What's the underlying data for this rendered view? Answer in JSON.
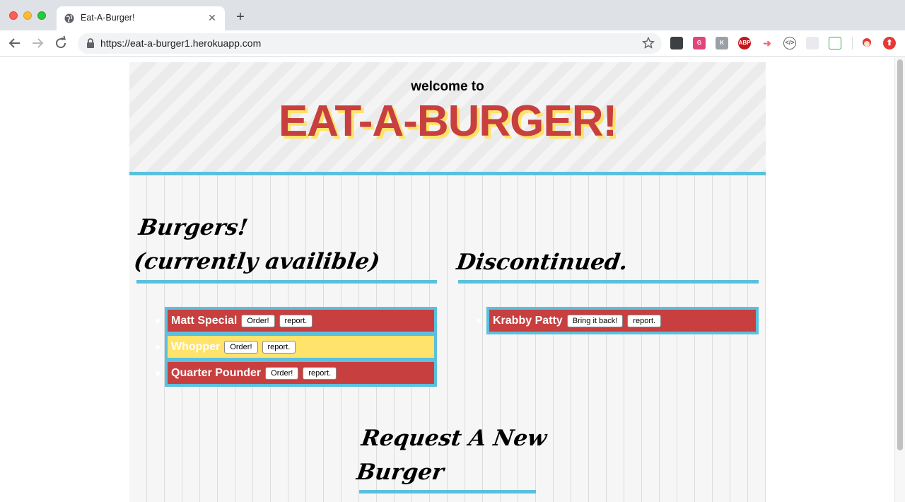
{
  "browser": {
    "tab_title": "Eat-A-Burger!",
    "tab_close": "✕",
    "new_tab": "+",
    "url": "https://eat-a-burger1.herokuapp.com"
  },
  "extensions": [
    "ext-dark",
    "ext-grammarly",
    "ext-k",
    "ext-abp",
    "ext-arrow",
    "ext-code",
    "ext-grid",
    "ext-edit",
    "ext-avatar",
    "ext-upload"
  ],
  "header": {
    "welcome": "welcome to",
    "brand": "EAT-A-BURGER!"
  },
  "available": {
    "heading_line1": "Burgers!",
    "heading_line2": "(currently availible)",
    "items": [
      {
        "name": "Matt Special",
        "action": "Order!",
        "report": "report.",
        "color": "#c83f3f"
      },
      {
        "name": "Whopper",
        "action": "Order!",
        "report": "report.",
        "color": "#ffe36a"
      },
      {
        "name": "Quarter Pounder",
        "action": "Order!",
        "report": "report.",
        "color": "#c83f3f"
      }
    ]
  },
  "discontinued": {
    "heading": "Discontinued.",
    "items": [
      {
        "name": "Krabby Patty",
        "action": "Bring it back!",
        "report": "report.",
        "color": "#c83f3f"
      }
    ]
  },
  "request": {
    "heading_line1": "Request A New",
    "heading_line2": "Burger"
  },
  "colors": {
    "accent_blue": "#5bc0de",
    "burger_red": "#c83f3f",
    "burger_yellow": "#ffe36a"
  }
}
